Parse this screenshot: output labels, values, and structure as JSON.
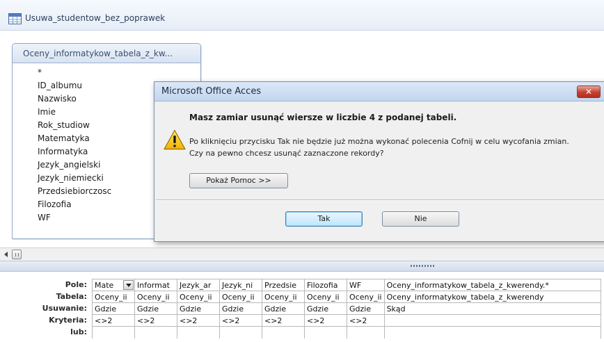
{
  "window": {
    "title": "Usuwa_studentow_bez_poprawek"
  },
  "table_box": {
    "title": "Oceny_informatykow_tabela_z_kw...",
    "fields": [
      "*",
      "ID_albumu",
      "Nazwisko",
      "Imie",
      "Rok_studiow",
      "Matematyka",
      "Informatyka",
      "Jezyk_angielski",
      "Jezyk_niemiecki",
      "Przedsiebiorczosc",
      "Filozofia",
      "WF"
    ]
  },
  "dialog": {
    "title": "Microsoft Office Acces",
    "close_label": "✕",
    "heading": "Masz zamiar usunąć wiersze w liczbie 4 z podanej tabeli.",
    "line1": "Po kliknięciu przycisku Tak nie będzie już można wykonać polecenia Cofnij w celu wycofania zmian.",
    "line2": "Czy na pewno chcesz usunąć zaznaczone rekordy?",
    "help_button": "Pokaż Pomoc >>",
    "yes_button": "Tak",
    "no_button": "Nie"
  },
  "grid": {
    "row_labels": [
      "Pole:",
      "Tabela:",
      "Usuwanie:",
      "Kryteria:",
      "lub:"
    ],
    "columns": [
      {
        "pole": "Mate",
        "tabela": "Oceny_ii",
        "usuwanie": "Gdzie",
        "kryteria": "<>2"
      },
      {
        "pole": "Informat",
        "tabela": "Oceny_ii",
        "usuwanie": "Gdzie",
        "kryteria": "<>2"
      },
      {
        "pole": "Jezyk_ar",
        "tabela": "Oceny_ii",
        "usuwanie": "Gdzie",
        "kryteria": "<>2"
      },
      {
        "pole": "Jezyk_ni",
        "tabela": "Oceny_ii",
        "usuwanie": "Gdzie",
        "kryteria": "<>2"
      },
      {
        "pole": "Przedsie",
        "tabela": "Oceny_ii",
        "usuwanie": "Gdzie",
        "kryteria": "<>2"
      },
      {
        "pole": "Filozofia",
        "tabela": "Oceny_ii",
        "usuwanie": "Gdzie",
        "kryteria": "<>2"
      },
      {
        "pole": "WF",
        "tabela": "Oceny_ii",
        "usuwanie": "Gdzie",
        "kryteria": "<>2"
      },
      {
        "pole": "Oceny_informatykow_tabela_z_kwerendy.*",
        "tabela": "Oceny_informatykow_tabela_z_kwerendy",
        "usuwanie": "Skąd",
        "kryteria": ""
      }
    ]
  }
}
